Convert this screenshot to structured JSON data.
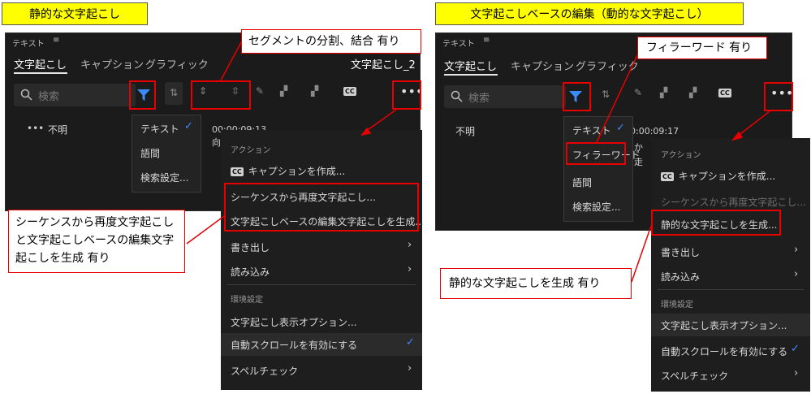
{
  "left": {
    "label": "静的な文字起こし",
    "panel_title": "テキスト",
    "tabs": [
      "文字起こし",
      "キャプション",
      "グラフィック"
    ],
    "sequence_name": "文字起こし_2",
    "search_placeholder": "検索",
    "speaker": "不明",
    "timecode": "00:00:09:13",
    "fragment": "向か",
    "filter_menu": [
      "テキスト",
      "語間",
      "検索設定..."
    ],
    "menu": {
      "section1": "アクション",
      "item_caption": "キャプションを作成...",
      "item_resequence": "シーケンスから再度文字起こし...",
      "item_generate": "文字起こしベースの編集文字起こしを生成...",
      "item_export": "書き出し",
      "item_import": "読み込み",
      "section2": "環境設定",
      "item_display": "文字起こし表示オプション...",
      "item_autoscroll": "自動スクロールを有効にする",
      "item_spell": "スペルチェック"
    },
    "callout_segment": "セグメントの分割、結合 有り",
    "callout_resequence": "シーケンスから再度文字起こしと文字起こしベースの編集文字起こしを生成 有り"
  },
  "right": {
    "label": "文字起こしベースの編集（動的な文字起こし）",
    "panel_title": "テキスト",
    "tabs": [
      "文字起こし",
      "キャプション",
      "グラフィック"
    ],
    "search_placeholder": "検索",
    "speaker": "不明",
    "timecode": "00:00:09:17",
    "fragment1": "か",
    "fragment2": "走",
    "filter_menu": [
      "テキスト",
      "フィラーワード",
      "語間",
      "検索設定..."
    ],
    "menu": {
      "section1": "アクション",
      "item_caption": "キャプションを作成...",
      "item_resequence": "シーケンスから再度文字起こし...",
      "item_static": "静的な文字起こしを生成...",
      "item_export": "書き出し",
      "item_import": "読み込み",
      "section2": "環境設定",
      "item_display": "文字起こし表示オプション...",
      "item_autoscroll": "自動スクロールを有効にする",
      "item_spell": "スペルチェック"
    },
    "callout_filler": "フィラーワード 有り",
    "callout_static": "静的な文字起こしを生成 有り"
  },
  "colors": {
    "highlight": "#e60000",
    "accent": "#3b8cff",
    "label_bg": "#ffff00"
  },
  "icons": [
    "search-icon",
    "filter-icon",
    "split-icon",
    "merge-icon",
    "pencil-icon",
    "cc-icon",
    "more-icon",
    "check-icon",
    "chevron-right-icon"
  ]
}
